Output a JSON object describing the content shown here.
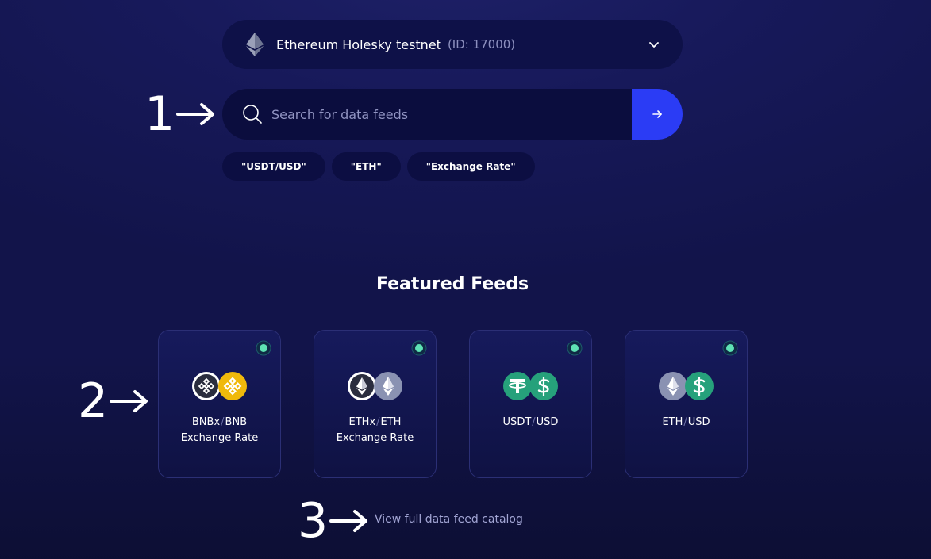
{
  "network": {
    "name": "Ethereum Holesky testnet",
    "id_text": "(ID: 17000)"
  },
  "search": {
    "placeholder": "Search for data feeds",
    "value": ""
  },
  "chips": [
    "\"USDT/USD\"",
    "\"ETH\"",
    "\"Exchange Rate\""
  ],
  "annotations": [
    "1",
    "2",
    "3"
  ],
  "featured": {
    "title": "Featured Feeds",
    "cards": [
      {
        "base": "BNBx",
        "sep": "/",
        "quote": "BNB",
        "subtitle": "Exchange Rate",
        "icons": [
          "bnbx-icon",
          "bnb-icon"
        ]
      },
      {
        "base": "ETHx",
        "sep": "/",
        "quote": "ETH",
        "subtitle": "Exchange Rate",
        "icons": [
          "ethx-icon",
          "eth-icon"
        ]
      },
      {
        "base": "USDT",
        "sep": "/",
        "quote": "USD",
        "subtitle": "",
        "icons": [
          "usdt-icon",
          "usd-icon"
        ]
      },
      {
        "base": "ETH",
        "sep": "/",
        "quote": "USD",
        "subtitle": "",
        "icons": [
          "eth-icon",
          "usd-icon"
        ]
      }
    ]
  },
  "catalog_link": "View full data feed catalog",
  "colors": {
    "accent": "#2b3cf5",
    "status": "#5ee3b4",
    "bnb": "#f0b90b",
    "usdt": "#26a17b",
    "eth_gray": "#8a92b2"
  }
}
